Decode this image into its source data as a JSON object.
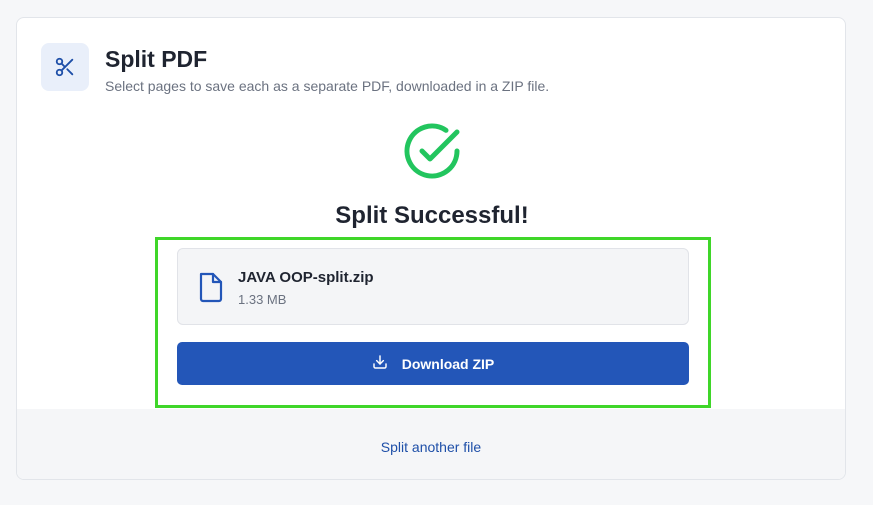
{
  "header": {
    "icon": "scissors-icon",
    "title": "Split PDF",
    "subtitle": "Select pages to save each as a separate PDF, downloaded in a ZIP file."
  },
  "result": {
    "icon": "check-circle-icon",
    "title": "Split Successful!",
    "file": {
      "icon": "file-icon",
      "name": "JAVA OOP-split.zip",
      "size": "1.33 MB"
    },
    "download": {
      "icon": "download-icon",
      "label": "Download ZIP"
    }
  },
  "footer": {
    "link_label": "Split another file"
  },
  "colors": {
    "accent": "#2356b8",
    "success": "#22c55e",
    "highlight": "#3fd629"
  }
}
